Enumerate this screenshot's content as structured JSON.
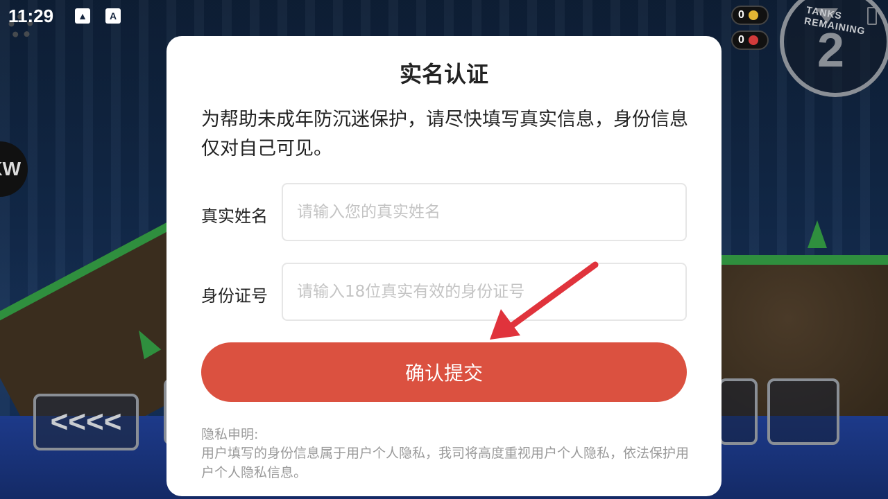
{
  "status_bar": {
    "time": "11:29",
    "icons": [
      "image-icon",
      "a-icon",
      "wifi-icon",
      "battery-icon"
    ]
  },
  "game_hud": {
    "coin_count": "0",
    "gem_count": "0",
    "tanks_label": "TANKS REMAINING",
    "tanks_remaining": "2",
    "badge_text": "KW",
    "back_button_label": "<<<<"
  },
  "dialog": {
    "title": "实名认证",
    "description": "为帮助未成年防沉迷保护，请尽快填写真实信息，身份信息仅对自己可见。",
    "name_field": {
      "label": "真实姓名",
      "value": "",
      "placeholder": "请输入您的真实姓名"
    },
    "id_field": {
      "label": "身份证号",
      "value": "",
      "placeholder": "请输入18位真实有效的身份证号"
    },
    "submit_label": "确认提交",
    "privacy_title": "隐私申明:",
    "privacy_text": "用户填写的身份信息属于用户个人隐私，我司将高度重视用户个人隐私，依法保护用户个人隐私信息。"
  },
  "colors": {
    "accent": "#db5140",
    "arrow": "#e0333c",
    "muted_text": "#9a9a9a"
  }
}
